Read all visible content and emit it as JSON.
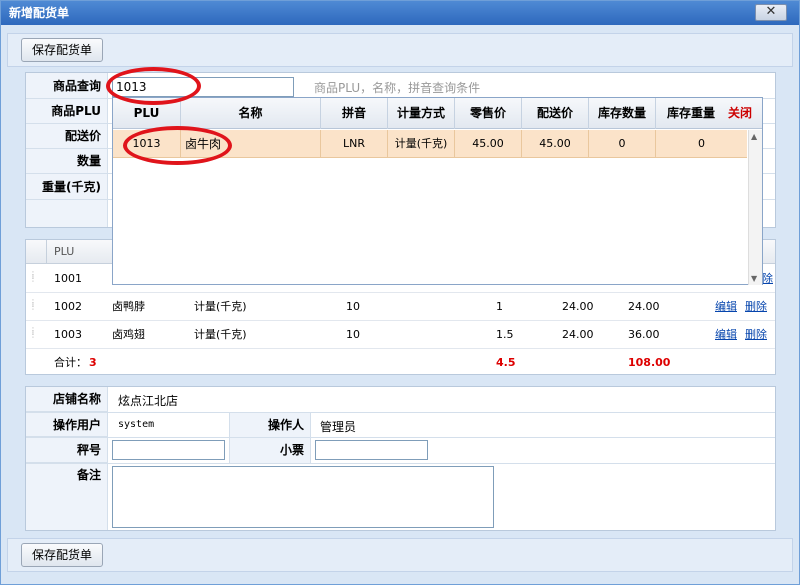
{
  "window": {
    "title": "新增配货单",
    "close_glyph": "✕"
  },
  "toolbar": {
    "save_label": "保存配货单"
  },
  "form": {
    "query_label": "商品查询",
    "query_value": "1013",
    "query_hint": "商品PLU，名称，拼音查询条件",
    "plu_label": "商品PLU",
    "price_label": "配送价",
    "qty_label": "数量",
    "weight_label": "重量(千克)"
  },
  "popup": {
    "columns": [
      "PLU",
      "名称",
      "拼音",
      "计量方式",
      "零售价",
      "配送价",
      "库存数量",
      "库存重量"
    ],
    "close_label": "关闭",
    "row": {
      "plu": "1013",
      "name": "卤牛肉",
      "pinyin": "LNR",
      "unit": "计量(千克)",
      "retail": "45.00",
      "delivery": "45.00",
      "stock_qty": "0",
      "stock_weight": "0"
    }
  },
  "grid": {
    "header_plu": "PLU",
    "rows": [
      {
        "plu": "1001",
        "name": "",
        "unit": "",
        "code": "",
        "weight": "",
        "price": "",
        "amount": "",
        "edit": "",
        "delete": "除"
      },
      {
        "plu": "1002",
        "name": "卤鸭脖",
        "unit": "计量(千克)",
        "code": "10",
        "weight": "1",
        "price": "24.00",
        "amount": "24.00",
        "edit": "编辑",
        "delete": "删除"
      },
      {
        "plu": "1003",
        "name": "卤鸡翅",
        "unit": "计量(千克)",
        "code": "10",
        "weight": "1.5",
        "price": "24.00",
        "amount": "36.00",
        "edit": "编辑",
        "delete": "删除"
      }
    ],
    "total_label": "合计：",
    "total_count": "3",
    "total_weight": "4.5",
    "total_amount": "108.00"
  },
  "info": {
    "store_label": "店铺名称",
    "store_value": "炫点江北店",
    "user_label": "操作用户",
    "user_value": "system",
    "operator_label": "操作人",
    "operator_value": "管理员",
    "scale_label": "秤号",
    "ticket_label": "小票",
    "note_label": "备注"
  }
}
